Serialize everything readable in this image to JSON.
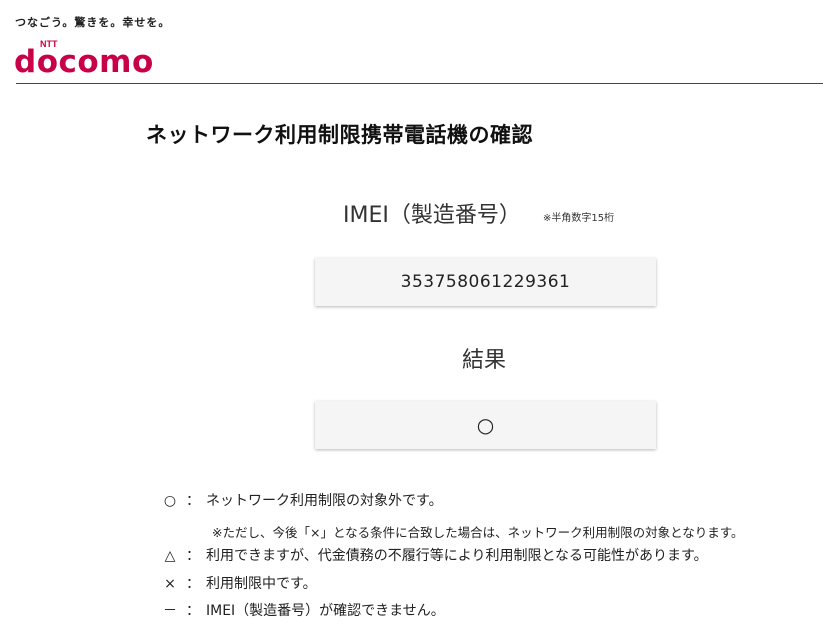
{
  "header": {
    "tagline": "つなごう。驚きを。幸せを。",
    "logo_small": "NTT",
    "logo_text": "docomo",
    "brand_color": "#c8004a"
  },
  "page_title": "ネットワーク利用制限携帯電話機の確認",
  "imei": {
    "label": "IMEI（製造番号）",
    "note": "※半角数字15桁",
    "value": "353758061229361"
  },
  "result": {
    "label": "結果",
    "value": "○"
  },
  "legend": {
    "items": [
      {
        "symbol": "○",
        "colon": "：",
        "text": "ネットワーク利用制限の対象外です。"
      },
      {
        "symbol": "△",
        "colon": "：",
        "text": "利用できますが、代金債務の不履行等により利用制限となる可能性があります。"
      },
      {
        "symbol": "×",
        "colon": "：",
        "text": "利用制限中です。"
      },
      {
        "symbol": "－",
        "colon": "：",
        "text": "IMEI（製造番号）が確認できません。"
      }
    ],
    "note": "※ただし、今後「×」となる条件に合致した場合は、ネットワーク利用制限の対象となります。"
  }
}
